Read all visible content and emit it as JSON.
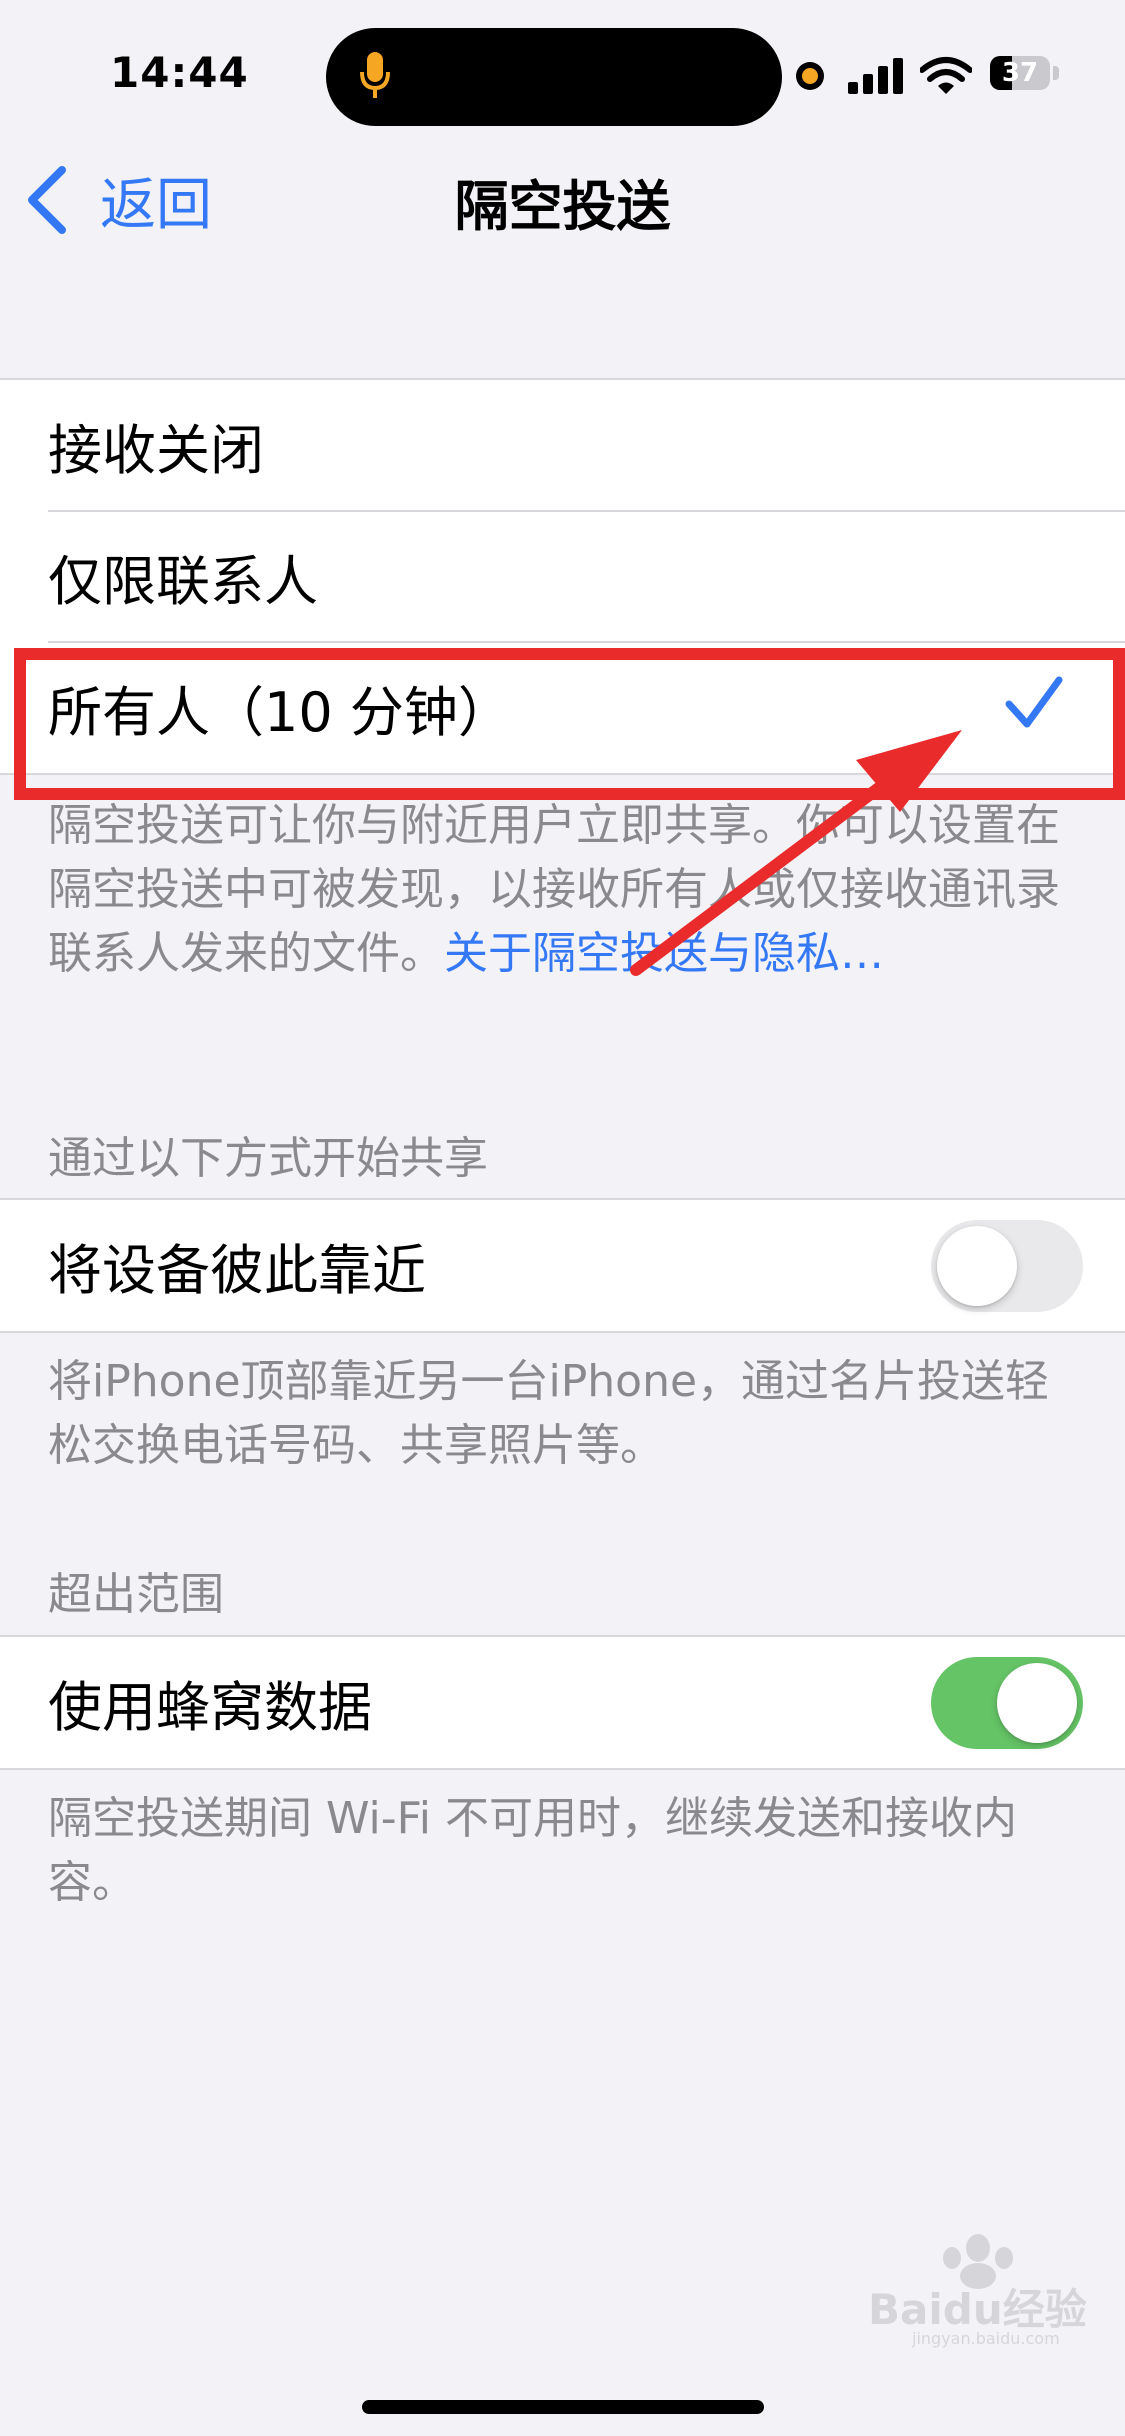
{
  "status_bar": {
    "time": "14:44",
    "battery_percent": "37",
    "battery_level": 0.37
  },
  "nav": {
    "back_label": "返回",
    "title": "隔空投送"
  },
  "receive_group": {
    "options": [
      {
        "label": "接收关闭",
        "selected": false
      },
      {
        "label": "仅限联系人",
        "selected": false
      },
      {
        "label": "所有人（10 分钟）",
        "selected": true
      }
    ],
    "footer_text": "隔空投送可让你与附近用户立即共享。你可以设置在隔空投送中可被发现，以接收所有人或仅接收通讯录联系人发来的文件。",
    "footer_link": "关于隔空投送与隐私…"
  },
  "start_sharing": {
    "header": "通过以下方式开始共享",
    "row_label": "将设备彼此靠近",
    "toggle_on": false,
    "footer_text": "将iPhone顶部靠近另一台iPhone，通过名片投送轻松交换电话号码、共享照片等。"
  },
  "out_of_range": {
    "header": "超出范围",
    "row_label": "使用蜂窝数据",
    "toggle_on": true,
    "footer_text": "隔空投送期间 Wi-Fi 不可用时，继续发送和接收内容。"
  },
  "colors": {
    "accent": "#3478f6",
    "toggle_on": "#65c466",
    "annotation": "#ea2b2b",
    "background": "#f2f2f7"
  },
  "icons": {
    "back": "chevron-left-icon",
    "check": "checkmark-icon",
    "mic": "microphone-icon",
    "signal": "cellular-signal-icon",
    "wifi": "wifi-icon",
    "battery": "battery-icon"
  },
  "watermark": {
    "text": "Baidu经验",
    "subtext": "jingyan.baidu.com"
  }
}
